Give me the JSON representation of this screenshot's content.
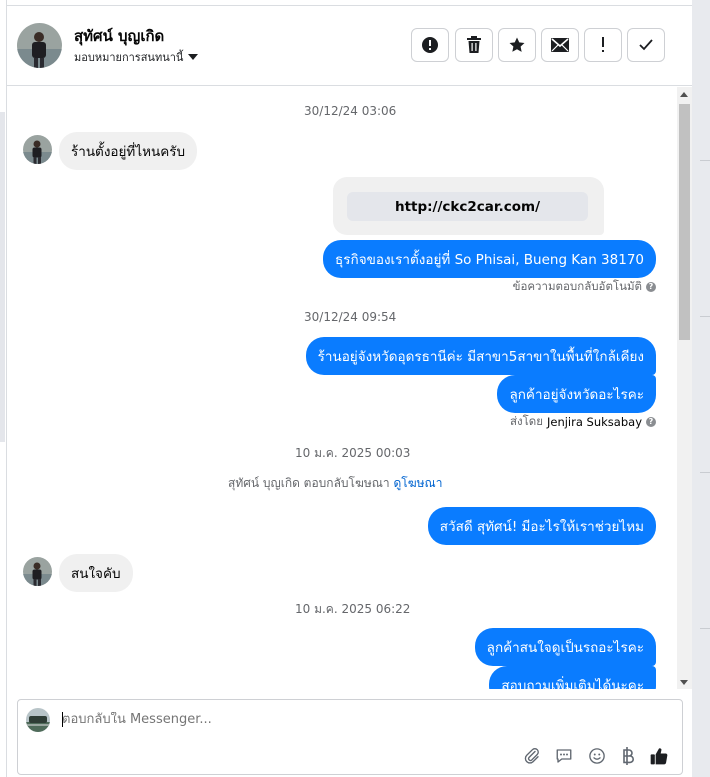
{
  "header": {
    "name": "สุทัศน์ บุญเกิด",
    "assign_label": "มอบหมายการสนทนานี้",
    "toolbar": [
      "report-icon",
      "trash-icon",
      "star-icon",
      "mail-icon",
      "exclamation-icon",
      "check-icon"
    ]
  },
  "messages": {
    "ts1": "30/12/24 03:06",
    "in1": "ร้านตั้งอยู่ที่ไหนครับ",
    "link": "http://ckc2car.com/",
    "out1": "ธุรกิจของเราตั้งอยู่ที่ So Phisai, Bueng Kan 38170",
    "auto_reply": "ข้อความตอบกลับอัตโนมัติ",
    "ts2": "30/12/24 09:54",
    "out2": "ร้านอยู่จังหวัดอุดรธานีค่ะ มีสาขา5สาขาในพื้นที่ใกล้เคียง",
    "out3": "ลูกค้าอยู่จังหวัดอะไรคะ",
    "sent_by_prefix": "ส่งโดย",
    "sent_by_name": "Jenjira Suksabay",
    "ts3": "10 ม.ค. 2025 00:03",
    "ad_text": "สุทัศน์ บุญเกิด ตอบกลับโฆษณา",
    "ad_link": "ดูโฆษณา",
    "out4": "สวัสดี สุทัศน์! มีอะไรให้เราช่วยไหม",
    "in2": "สนใจคับ",
    "ts4": "10 ม.ค. 2025 06:22",
    "out5": "ลูกค้าสนใจดูเป็นรถอะไรคะ",
    "out6": "สอบถามเพิ่มเติมได้นะคะ"
  },
  "composer": {
    "placeholder": "ตอบกลับใน Messenger...",
    "icons": [
      "attachment-icon",
      "saved-reply-icon",
      "emoji-icon",
      "baht-icon",
      "like-icon"
    ]
  },
  "colors": {
    "outgoing_bubble": "#0a7cff",
    "incoming_bubble": "#f0f0f0",
    "link": "#0064d1"
  }
}
